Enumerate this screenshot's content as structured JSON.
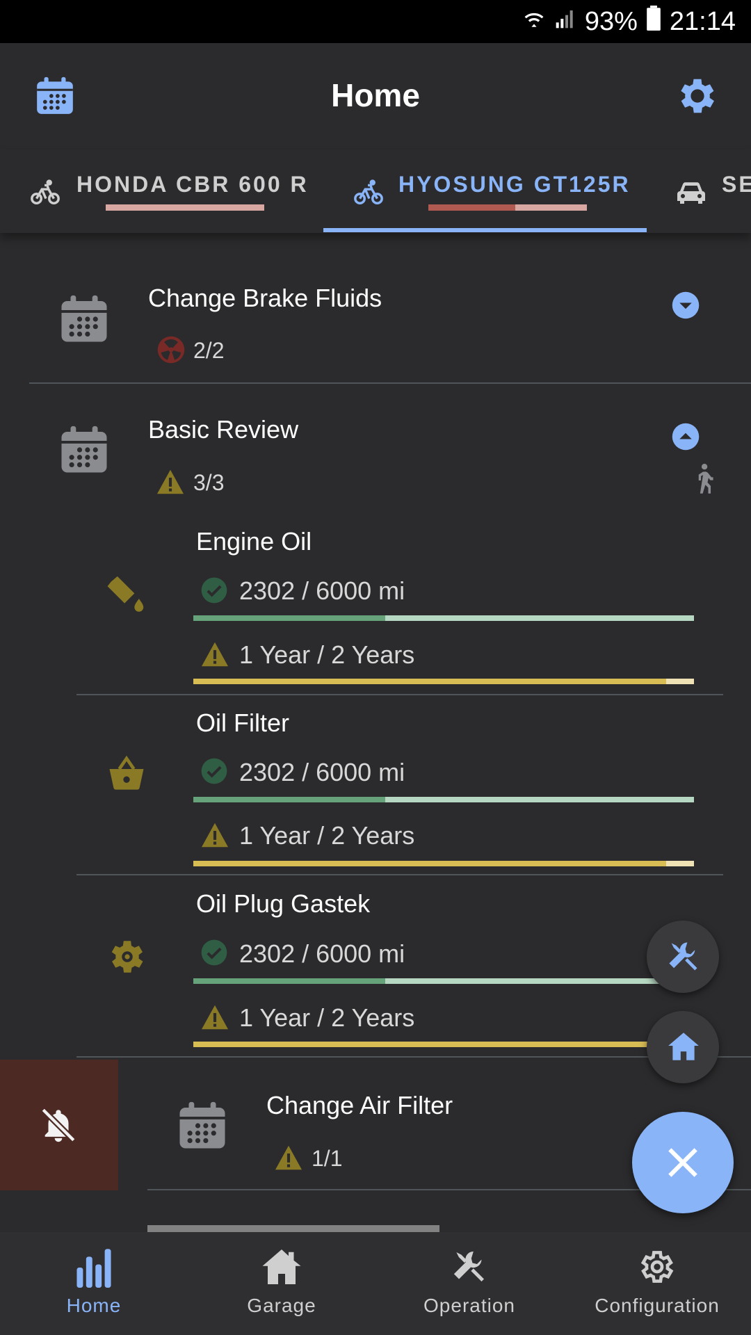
{
  "status_bar": {
    "battery": "93%",
    "time": "21:14"
  },
  "app_bar": {
    "title": "Home"
  },
  "tabs": [
    {
      "label": "HONDA CBR 600 R",
      "icon": "bike-icon",
      "selected": false
    },
    {
      "label": "HYOSUNG GT125R",
      "icon": "bike-icon",
      "selected": true
    },
    {
      "label": "SE",
      "icon": "car-icon",
      "selected": false
    }
  ],
  "reminders": [
    {
      "title": "Change Brake Fluids",
      "badge": "2/2",
      "status_icon": "overdue-icon",
      "expand": "chevron-down-icon"
    },
    {
      "title": "Basic Review",
      "badge": "3/3",
      "status_icon": "warning-icon",
      "expand": "chevron-up-icon",
      "tasks": [
        {
          "name": "Engine Oil",
          "icon": "oil-can-icon",
          "distance": "2302 / 6000 mi",
          "distance_fraction": 0.384,
          "time": "1 Year / 2 Years",
          "time_fraction": 0.944
        },
        {
          "name": "Oil Filter",
          "icon": "basket-icon",
          "distance": "2302 / 6000 mi",
          "distance_fraction": 0.384,
          "time": "1 Year / 2 Years",
          "time_fraction": 0.944
        },
        {
          "name": "Oil Plug Gastek",
          "icon": "gear-icon",
          "distance": "2302 / 6000 mi",
          "distance_fraction": 0.384,
          "time": "1 Year / 2 Years",
          "time_fraction": 0.944
        }
      ]
    },
    {
      "title": "Change Air Filter",
      "badge": "1/1",
      "status_icon": "warning-icon"
    }
  ],
  "bottom_nav": [
    {
      "label": "Home",
      "active": true
    },
    {
      "label": "Garage",
      "active": false
    },
    {
      "label": "Operation",
      "active": false
    },
    {
      "label": "Configuration",
      "active": false
    }
  ],
  "colors": {
    "accent": "#8ab4f8",
    "background": "#2b2b2d",
    "warning": "#8a7a25",
    "ok_green": "#66a37a",
    "ok_track": "#b6d7c1",
    "time_bar": "#d8bd55",
    "time_track": "#efe3b5",
    "snooze_bg": "#4d2924"
  }
}
